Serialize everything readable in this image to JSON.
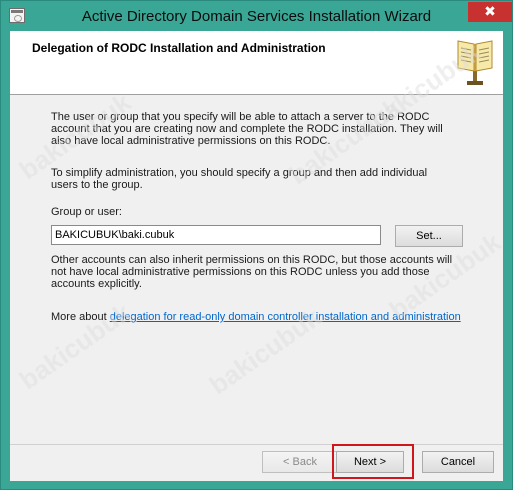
{
  "window": {
    "title": "Active Directory Domain Services Installation Wizard",
    "close_glyph": "✖"
  },
  "header": {
    "title": "Delegation of RODC Installation and Administration",
    "icon": "book-icon"
  },
  "content": {
    "intro": "The user or group that you specify will be able to attach a server to the RODC account that you are creating now and complete the RODC installation. They will also have local administrative permissions on this RODC.",
    "simplify": "To simplify administration, you should specify a group and then add individual users to the group.",
    "group_label": "Group or user:",
    "group_value": "BAKICUBUK\\baki.cubuk",
    "set_button": "Set...",
    "other_accounts": "Other accounts can also inherit permissions on this RODC, but those accounts will not have local administrative permissions on this RODC unless you add those accounts explicitly.",
    "more_about": "More about ",
    "more_link": "delegation for read-only domain controller installation and administration"
  },
  "buttons": {
    "back": "< Back",
    "next": "Next >",
    "cancel": "Cancel"
  },
  "watermark": "bakicubuk",
  "colors": {
    "titlebar": "#3aa796",
    "close": "#c7312f",
    "link": "#0066cc",
    "highlight": "#d0151b"
  }
}
